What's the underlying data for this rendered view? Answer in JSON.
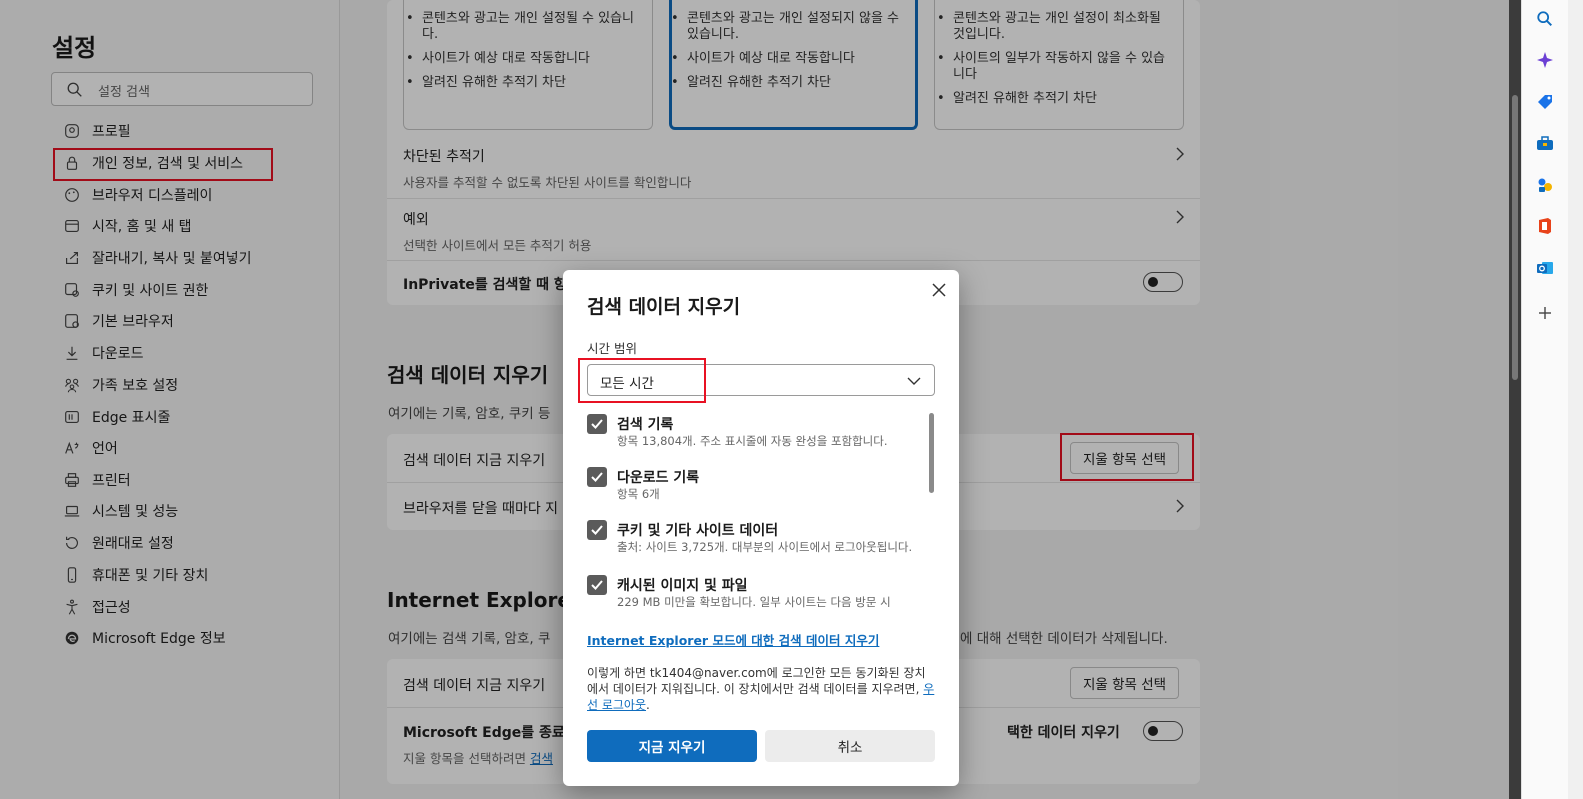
{
  "sidebar": {
    "title": "설정",
    "search_placeholder": "설정 검색",
    "items": [
      {
        "label": "프로필"
      },
      {
        "label": "개인 정보, 검색 및 서비스"
      },
      {
        "label": "브라우저 디스플레이"
      },
      {
        "label": "시작, 홈 및 새 탭"
      },
      {
        "label": "잘라내기, 복사 및 붙여넣기"
      },
      {
        "label": "쿠키 및 사이트 권한"
      },
      {
        "label": "기본 브라우저"
      },
      {
        "label": "다운로드"
      },
      {
        "label": "가족 보호 설정"
      },
      {
        "label": "Edge 표시줄"
      },
      {
        "label": "언어"
      },
      {
        "label": "프린터"
      },
      {
        "label": "시스템 및 성능"
      },
      {
        "label": "원래대로 설정"
      },
      {
        "label": "휴대폰 및 기타 장치"
      },
      {
        "label": "접근성"
      },
      {
        "label": "Microsoft Edge 정보"
      }
    ]
  },
  "tracking": {
    "col1": [
      "콘텐츠와 광고는 개인 설정될 수 있습니다.",
      "사이트가 예상 대로 작동합니다",
      "알려진 유해한 추적기 차단"
    ],
    "col2": [
      "콘텐츠와 광고는 개인 설정되지 않을 수 있습니다.",
      "사이트가 예상 대로 작동합니다",
      "알려진 유해한 추적기 차단"
    ],
    "col3": [
      "콘텐츠와 광고는 개인 설정이 최소화될 것입니다.",
      "사이트의 일부가 작동하지 않을 수 있습니다",
      "알려진 유해한 추적기 차단"
    ],
    "blocked_title": "차단된 추적기",
    "blocked_desc": "사용자를 추적할 수 없도록 차단된 사이트를 확인합니다",
    "exceptions_title": "예외",
    "exceptions_desc": "선택한 사이트에서 모든 추적기 허용",
    "inprivate_label": "InPrivate를 검색할 때 항"
  },
  "clear_section": {
    "heading": "검색 데이터 지우기",
    "desc": "여기에는 기록, 암호, 쿠키 등",
    "row1_label": "검색 데이터 지금 지우기",
    "row1_button": "지울 항목 선택",
    "row2_label": "브라우저를 닫을 때마다 지"
  },
  "ie_section": {
    "heading": "Internet Explorer의",
    "desc_left": "여기에는 검색 기록, 암호, 쿠",
    "desc_right": "에 대해 선택한 데이터가 삭제됩니다.",
    "row1_label": "검색 데이터 지금 지우기",
    "row1_button": "지울 항목 선택",
    "row2_label": "Microsoft Edge를 종료할",
    "row2_label_right": "택한 데이터 지우기",
    "row2_sub": "지울 항목을 선택하려면",
    "row2_link": "검색"
  },
  "dialog": {
    "title": "검색 데이터 지우기",
    "time_range_label": "시간 범위",
    "time_range_value": "모든 시간",
    "items": [
      {
        "label": "검색 기록",
        "desc": "항목 13,804개. 주소 표시줄에 자동 완성을 포함합니다.",
        "checked": true
      },
      {
        "label": "다운로드 기록",
        "desc": "항목 6개",
        "checked": true
      },
      {
        "label": "쿠키 및 기타 사이트 데이터",
        "desc": "출처: 사이트 3,725개. 대부분의 사이트에서 로그아웃됩니다.",
        "checked": true
      },
      {
        "label": "캐시된 이미지 및 파일",
        "desc": "229 MB 미만을 확보합니다. 일부 사이트는 다음 방문 시",
        "checked": true
      }
    ],
    "ie_link": "Internet Explorer 모드에 대한 검색 데이터 지우기",
    "notice_text": "이렇게 하면 tk1404@naver.com에 로그인한 모든 동기화된 장치에서 데이터가 지워집니다. 이 장치에서만 검색 데이터를 지우려면,",
    "notice_link": "우선 로그아웃",
    "notice_end": ".",
    "primary_button": "지금 지우기",
    "cancel_button": "취소"
  },
  "colors": {
    "accent": "#0f6cbd",
    "highlight": "#e81123"
  }
}
